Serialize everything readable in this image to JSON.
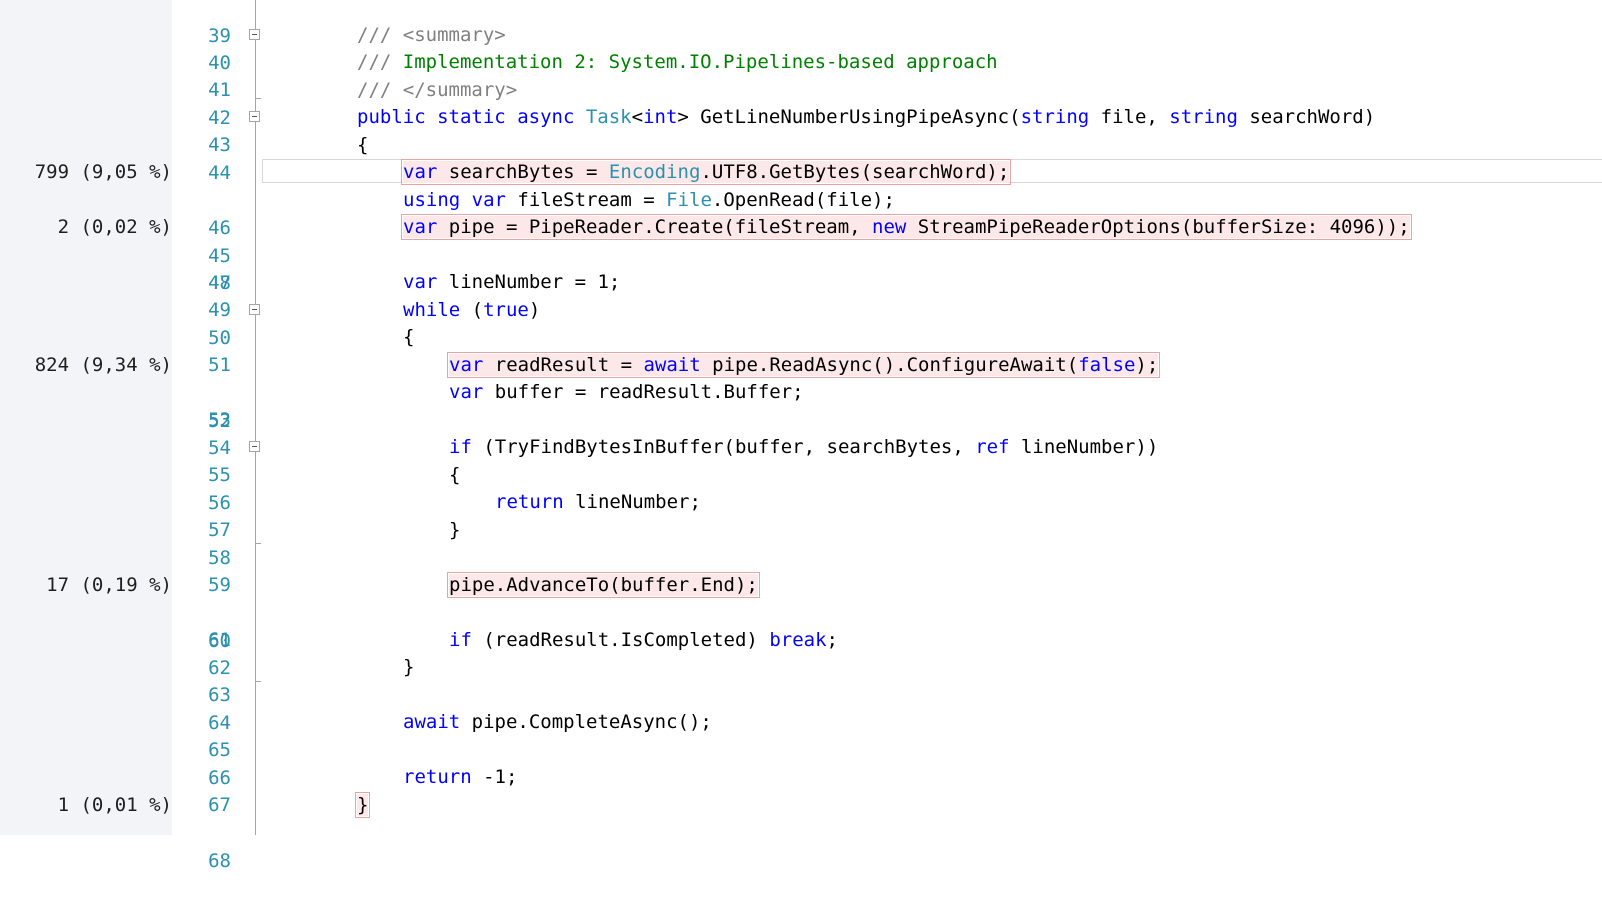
{
  "gutter": {
    "perf_45": "799 (9,05 %)",
    "perf_47": "2 (0,02 %)",
    "perf_52": "824 (9,34 %)",
    "perf_60": "17 (0,19 %)",
    "perf_68": "1 (0,01 %)"
  },
  "line_numbers": [
    "39",
    "40",
    "41",
    "42",
    "43",
    "44",
    "45",
    "46",
    "47",
    "48",
    "49",
    "50",
    "51",
    "52",
    "53",
    "54",
    "55",
    "56",
    "57",
    "58",
    "59",
    "60",
    "61",
    "62",
    "63",
    "64",
    "65",
    "66",
    "67",
    "68"
  ],
  "code": {
    "l40_prefix": "/// ",
    "l40_tag": "<summary>",
    "l41_prefix": "/// ",
    "l41_text": "Implementation 2: System.IO.Pipelines-based approach",
    "l42_prefix": "/// ",
    "l42_tag": "</summary>",
    "l43": {
      "public": "public",
      "static": "static",
      "async": "async",
      "task": "Task",
      "lt": "<",
      "int": "int",
      "gt_name": "> GetLineNumberUsingPipeAsync(",
      "string1": "string",
      "file": " file, ",
      "string2": "string",
      "rest": " searchWord)"
    },
    "l44": "{",
    "l45": {
      "var": "var",
      "a": " searchBytes = ",
      "encoding": "Encoding",
      "b": ".UTF8.GetBytes(searchWord);"
    },
    "l46": {
      "using": "using",
      "var": "var",
      "a": " fileStream = ",
      "file": "File",
      "b": ".OpenRead(file);"
    },
    "l47": {
      "var": "var",
      "a": " pipe = PipeReader.Create(fileStream, ",
      "new": "new",
      "b": " StreamPipeReaderOptions(bufferSize: 4096));"
    },
    "l49": {
      "var": "var",
      "a": " lineNumber = 1;"
    },
    "l50": {
      "while": "while",
      "a": " (",
      "true": "true",
      "b": ")"
    },
    "l51": "{",
    "l52": {
      "var": "var",
      "a": " readResult = ",
      "await": "await",
      "b": " pipe.ReadAsync().ConfigureAwait(",
      "false": "false",
      "c": ");"
    },
    "l53": {
      "var": "var",
      "a": " buffer = readResult.Buffer;"
    },
    "l55": {
      "if": "if",
      "a": " (TryFindBytesInBuffer(buffer, searchBytes, ",
      "ref": "ref",
      "b": " lineNumber))"
    },
    "l56": "{",
    "l57": {
      "return": "return",
      "a": " lineNumber;"
    },
    "l58": "}",
    "l60": "pipe.AdvanceTo(buffer.End);",
    "l62": {
      "if": "if",
      "a": " (readResult.IsCompleted) ",
      "break": "break",
      "b": ";"
    },
    "l63": "}",
    "l65": {
      "await": "await",
      "a": " pipe.CompleteAsync();"
    },
    "l67": {
      "return": "return",
      "a": " -1;"
    },
    "l68": "}"
  },
  "colors": {
    "keyword": "#0000ff",
    "type": "#2b91af",
    "comment": "#008000",
    "xml_tag": "#808080",
    "line_number": "#2b91af",
    "hot_highlight_bg": "#fce8e8",
    "hot_highlight_border": "#e8a3a3"
  },
  "icons": [
    "collapse-box-icon"
  ]
}
